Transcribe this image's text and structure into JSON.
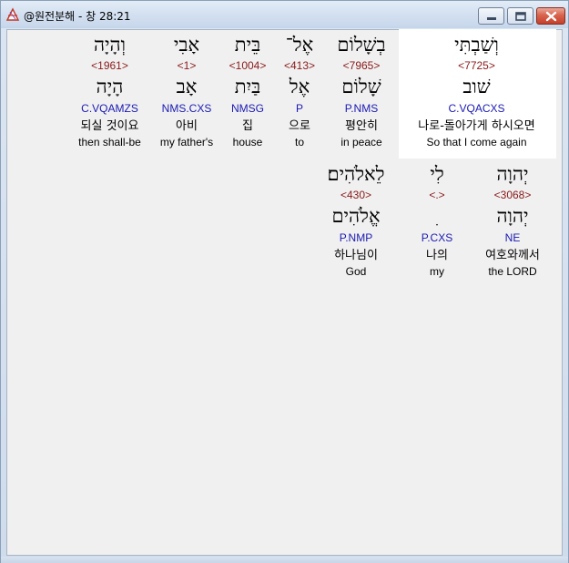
{
  "window": {
    "title": "@원전분해 - 창 28:21"
  },
  "rows": [
    {
      "words": [
        {
          "hebrew": "וְשַׁבְתִּי",
          "strong": "<7725>",
          "root": "שׁוב",
          "morph": "C.VQACXS",
          "korean": "나로-돌아가게 하시오면",
          "english": "So that I come again",
          "highlighted": true
        },
        {
          "hebrew": "בְשָׁלוֹם",
          "strong": "<7965>",
          "root": "שָׁלוֹם",
          "morph": "P.NMS",
          "korean": "평안히",
          "english": "in peace",
          "highlighted": false
        },
        {
          "hebrew": "אֶל־",
          "strong": "<413>",
          "root": "אֶל",
          "morph": "P",
          "korean": "으로",
          "english": "to",
          "highlighted": false
        },
        {
          "hebrew": "בֵּית",
          "strong": "<1004>",
          "root": "בַּיִת",
          "morph": "NMSG",
          "korean": "집",
          "english": "house",
          "highlighted": false
        },
        {
          "hebrew": "אָבִי",
          "strong": "<1>",
          "root": "אָב",
          "morph": "NMS.CXS",
          "korean": "아비",
          "english": "my father's",
          "highlighted": false
        },
        {
          "hebrew": "וְהָיָה",
          "strong": "<1961>",
          "root": "הָיָה",
          "morph": "C.VQAMZS",
          "korean": "되실 것이요",
          "english": "then shall-be",
          "highlighted": false
        }
      ]
    },
    {
      "words": [
        {
          "hebrew": "יְהוָה",
          "strong": "<3068>",
          "root": "יְהוָה",
          "morph": "NE",
          "korean": "여호와께서",
          "english": "the LORD",
          "highlighted": false
        },
        {
          "hebrew": "לִי",
          "strong": "<.>",
          "root": "ִ",
          "morph": "P.CXS",
          "korean": "나의",
          "english": "my",
          "highlighted": false
        },
        {
          "hebrew": "לֵאלֹהִים׃",
          "strong": "<430>",
          "root": "אֱלֹהִים",
          "morph": "P.NMP",
          "korean": "하나님이",
          "english": "God",
          "highlighted": false
        }
      ]
    }
  ]
}
